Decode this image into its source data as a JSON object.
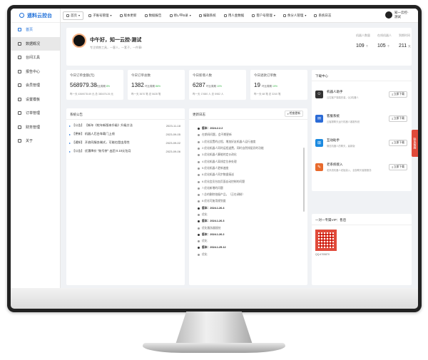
{
  "sidebar": {
    "logo": "遥料云控台",
    "items": [
      {
        "label": "首页",
        "icon": "home-icon"
      },
      {
        "label": "数据概况",
        "icon": "chart-icon"
      },
      {
        "label": "台间工具",
        "icon": "tool-icon"
      },
      {
        "label": "报告中心",
        "icon": "report-icon"
      },
      {
        "label": "会员管理",
        "icon": "member-icon"
      },
      {
        "label": "设置模板",
        "icon": "template-icon"
      },
      {
        "label": "订单管理",
        "icon": "order-icon"
      },
      {
        "label": "财务管理",
        "icon": "finance-icon"
      },
      {
        "label": "关于",
        "icon": "info-icon"
      }
    ]
  },
  "topbar": {
    "tabs": [
      {
        "label": "首页"
      },
      {
        "label": "子账号管理"
      },
      {
        "label": "版本更新"
      },
      {
        "label": "数据报告"
      },
      {
        "label": "修L/平B录"
      },
      {
        "label": "编辑系统"
      },
      {
        "label": "用人金数据"
      },
      {
        "label": "客户号管理"
      },
      {
        "label": "余分人管理"
      },
      {
        "label": "系统日志"
      }
    ],
    "user_name": "知一云控-测试"
  },
  "welcome": {
    "greeting": "中午好，知一云控-测试",
    "subtitle": "专注销售工具，一客人，一套子，一件事!",
    "stats": [
      {
        "label": "机器人数量",
        "value": "109",
        "unit": "个"
      },
      {
        "label": "在线机器人",
        "value": "105",
        "unit": "个"
      },
      {
        "label": "到期时间",
        "value": "211",
        "unit": "天"
      }
    ]
  },
  "metrics": [
    {
      "title": "今日订单金额(元)",
      "value": "568979.38",
      "ratio_label": "环比周期",
      "ratio": "8%",
      "footer": "昨一天 4369078.69 元  总 380476.26 元"
    },
    {
      "title": "今日订单总数",
      "value": "1382",
      "ratio_label": "环比周期",
      "ratio": "86%",
      "footer": "昨一天 3670 笔  总 5628 笔"
    },
    {
      "title": "今日新增人数",
      "value": "6287",
      "ratio_label": "环比周期",
      "ratio": "10%",
      "footer": "昨一天 17680 人  总 5982 人"
    },
    {
      "title": "今日退款订单数",
      "value": "19",
      "ratio_label": "环比周期",
      "ratio": "19%",
      "footer": "昨一天 68 笔  总 3240 笔"
    }
  ],
  "notices": {
    "title": "系统公告",
    "rows": [
      {
        "text": "【公告】 【新年《蛇年新版本升级》升级方法",
        "date": "2023-11-18"
      },
      {
        "text": "【更新】 机器人后台车载门上线",
        "date": "2023-09-05"
      },
      {
        "text": "【通知】 开放同服务端式，可能也是由用性",
        "date": "2023-09-02"
      },
      {
        "text": "【公告】 优惠降价 “账号拼” 出团 0.10元包月",
        "date": "2023-09-06"
      }
    ]
  },
  "changelog": {
    "title": "更新日志",
    "check_button": "检查更新",
    "lines": [
      {
        "text": "版本：2024.2.2.2",
        "version": true
      },
      {
        "text": "在期间问题，会不期更新",
        "version": false
      },
      {
        "text": "1.优化设置的过程，增加好友机器人运行速度",
        "version": false
      },
      {
        "text": "2.优化机器人同时运程退费，同时自然排配识的功能",
        "version": false
      },
      {
        "text": "3.优化机器人算能的定价改化",
        "version": false
      },
      {
        "text": "4.优化机器人离线定位参处理",
        "version": false
      },
      {
        "text": "5.优化机器人更新速度",
        "version": false
      },
      {
        "text": "6.优化机器人同步数据接送",
        "version": false
      },
      {
        "text": "6.优化会员台加页面自动控制的问题",
        "version": false
      },
      {
        "text": "7.优化新增的问题",
        "version": false
      },
      {
        "text": "7.总的删除拍摄产品，（正在调制）",
        "version": false
      },
      {
        "text": "8.优化可复用规划度",
        "version": false
      },
      {
        "text": "版本：2024.1.26.4",
        "version": true
      },
      {
        "text": "优化",
        "version": false
      },
      {
        "text": "版本：2024.1.26.3",
        "version": true
      },
      {
        "text": "优化服务器接处",
        "version": false
      },
      {
        "text": "版本：2024.1.26.2",
        "version": true
      },
      {
        "text": "优化",
        "version": false
      },
      {
        "text": "版本：2024.1.25.12",
        "version": true
      },
      {
        "text": "优化",
        "version": false
      }
    ]
  },
  "downloads": {
    "title": "下载中心",
    "items": [
      {
        "name": "机器人助手",
        "desc": "云控客户端端安装，QQ机器人",
        "button": "立即下载",
        "color": "#333333",
        "icon": "robot-icon"
      },
      {
        "name": "客服系统",
        "desc": "云客服聊天运行机器人客服系统",
        "button": "立即下载",
        "color": "#2b6bd6",
        "icon": "service-icon"
      },
      {
        "name": "互动助手",
        "desc": "微信机器人的聊天，最新版",
        "button": "立即下载",
        "color": "#1b8ae0",
        "icon": "windows-icon"
      },
      {
        "name": "老系统接入",
        "desc": "老系统机器人老板接入，全部聊天客服服务",
        "button": "立即下载",
        "color": "#e86a2c",
        "icon": "link-icon"
      }
    ]
  },
  "qrcard": {
    "title": "一对一专属VIP：售后",
    "caption": "QQ:4705870"
  },
  "float_tab": "联系客服"
}
